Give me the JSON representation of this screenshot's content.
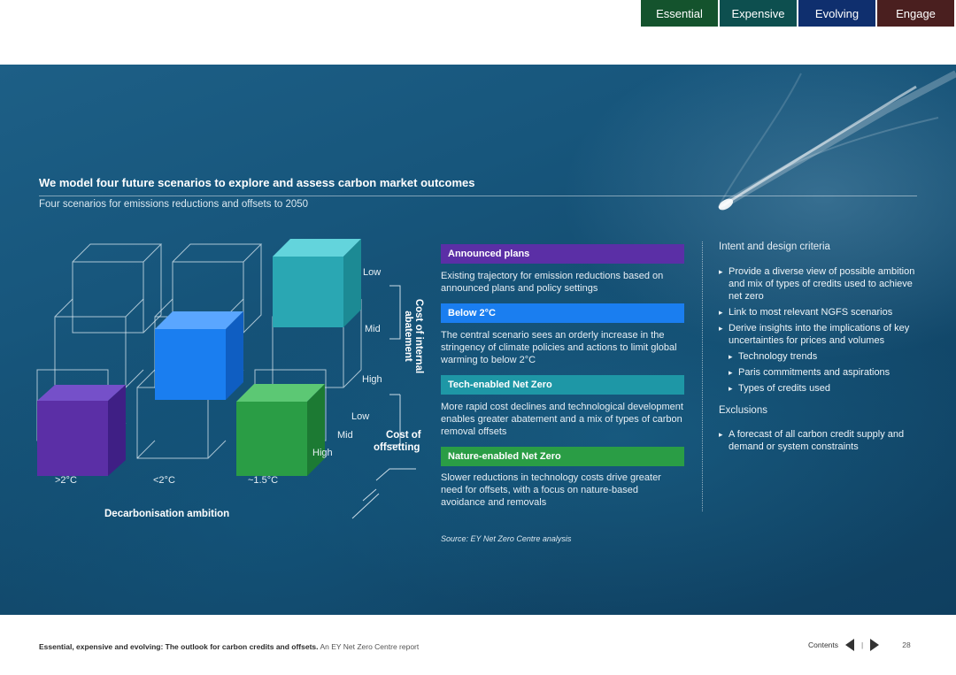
{
  "tabs": [
    "Essential",
    "Expensive",
    "Evolving",
    "Engage"
  ],
  "title": "We model four future scenarios to explore and assess carbon market outcomes",
  "subtitle": "Four scenarios for emissions reductions and offsets to 2050",
  "diagram": {
    "vertical_axis": "Cost of internal abatement",
    "vertical_levels": [
      "Low",
      "Mid",
      "High"
    ],
    "depth_axis": [
      "Cost of",
      "offsetting"
    ],
    "depth_levels": [
      "Low",
      "Mid",
      "High"
    ],
    "x_levels": [
      ">2°C",
      "<2°C",
      "~1.5°C"
    ],
    "x_axis": "Decarbonisation ambition"
  },
  "scenarios": [
    {
      "name": "Announced plans",
      "color": "#5b2fa6",
      "text": "Existing trajectory for emission reductions based on announced plans and policy settings"
    },
    {
      "name": "Below 2°C",
      "color": "#1a7ef0",
      "text": "The central scenario sees an orderly increase in the stringency of climate policies and actions to limit global warming to below 2°C"
    },
    {
      "name": "Tech-enabled Net Zero",
      "color": "#1e97a6",
      "text": "More rapid cost declines and technological development enables greater abatement and a mix of types of carbon removal offsets"
    },
    {
      "name": "Nature-enabled Net Zero",
      "color": "#2a9d45",
      "text": "Slower reductions in technology costs drive greater need for offsets, with a focus on nature-based avoidance and removals"
    }
  ],
  "source": "Source: EY Net Zero Centre analysis",
  "criteria": {
    "heading": "Intent and design criteria",
    "items": [
      "Provide a diverse view of possible ambition and mix of types of credits used to achieve net zero",
      "Link to most relevant NGFS scenarios",
      "Derive insights into the implications of key uncertainties for prices and volumes"
    ],
    "sub_items": [
      "Technology trends",
      "Paris commitments and aspirations",
      "Types of credits used"
    ],
    "exclusions_heading": "Exclusions",
    "exclusions": [
      "A forecast of all carbon credit supply and demand or system constraints"
    ]
  },
  "footer": {
    "report_title": "Essential, expensive and evolving: The outlook for carbon credits and offsets.",
    "report_suffix": "An EY Net Zero Centre report",
    "contents": "Contents",
    "separator": "|",
    "page": "28"
  },
  "colors": {
    "tab_essential": "#14532d",
    "tab_expensive": "#0d4f4f",
    "tab_evolving": "#0f2f6e",
    "tab_engage": "#4a1f1f",
    "cube_purple": "#5b2fa6",
    "cube_blue": "#1a7ef0",
    "cube_teal": "#2aa7b3",
    "cube_green": "#2a9d45"
  }
}
